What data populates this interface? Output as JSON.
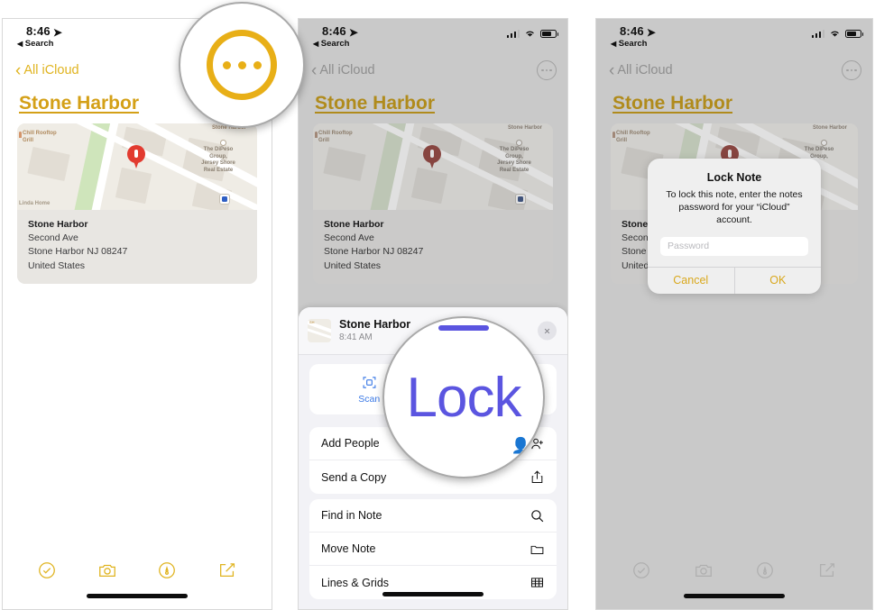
{
  "panels": [
    {
      "status": {
        "time": "8:46",
        "back_label": "Search"
      },
      "nav": {
        "back_label": "All iCloud"
      },
      "note_title": "Stone Harbor",
      "map": {
        "labels": {
          "chill": "Chill Rooftop\nGrill",
          "stone": "Stone Harbor",
          "dipeso": "The DiPeso\nGroup,\nJersey Shore\nReal Estate",
          "home": "Linda Home"
        },
        "address": {
          "name": "Stone Harbor",
          "street": "Second Ave",
          "city": "Stone Harbor NJ 08247",
          "country": "United States"
        }
      },
      "toolbar": [
        "checkmark-circle-icon",
        "camera-icon",
        "markup-pen-icon",
        "compose-icon"
      ]
    },
    {
      "status": {
        "time": "8:46",
        "back_label": "Search"
      },
      "nav": {
        "back_label": "All iCloud"
      },
      "note_title": "Stone Harbor",
      "sheet": {
        "note_name": "Stone Harbor",
        "note_time": "8:41 AM",
        "close_label": "×",
        "quick": [
          {
            "label": "Scan",
            "icon": "scan-icon"
          },
          {
            "label": "",
            "icon": "lock-icon"
          }
        ],
        "rows_group_1": [
          {
            "label": "Add People",
            "icon": "add-person-icon"
          },
          {
            "label": "Send a Copy",
            "icon": "share-icon"
          }
        ],
        "rows_group_2": [
          {
            "label": "Find in Note",
            "icon": "search-icon"
          },
          {
            "label": "Move Note",
            "icon": "folder-icon"
          },
          {
            "label": "Lines & Grids",
            "icon": "grid-icon"
          }
        ]
      }
    },
    {
      "status": {
        "time": "8:46",
        "back_label": "Search"
      },
      "nav": {
        "back_label": "All iCloud"
      },
      "note_title": "Stone Harbor",
      "alert": {
        "title": "Lock Note",
        "message": "To lock this note, enter the notes password for your “iCloud” account.",
        "password_placeholder": "Password",
        "cancel_label": "Cancel",
        "ok_label": "OK"
      }
    }
  ],
  "callouts": {
    "ellipsis": {
      "name": "ellipsis-button-magnified"
    },
    "lock": {
      "label": "Lock"
    }
  },
  "colors": {
    "accent_gold": "#e0b420",
    "title_gold": "#d4a017",
    "blue": "#3a79e6",
    "lock_purple": "#5b55e0",
    "pin_red": "#e23b30"
  }
}
